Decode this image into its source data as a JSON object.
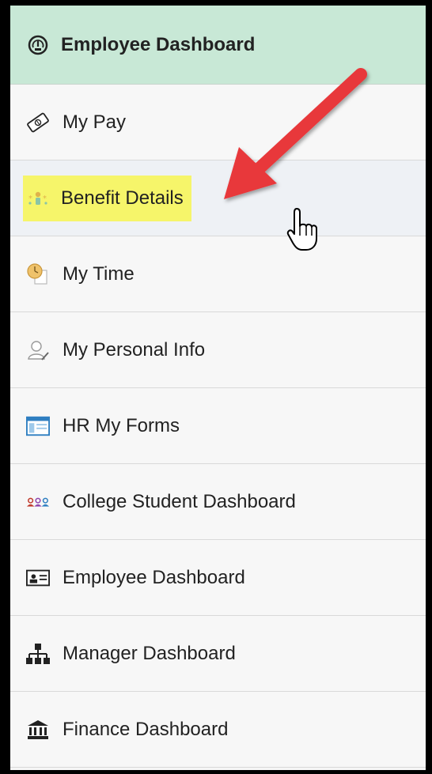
{
  "header": {
    "label": "Employee Dashboard",
    "icon": "dashboard-gauge-icon"
  },
  "items": [
    {
      "label": "My Pay",
      "icon": "money-icon"
    },
    {
      "label": "Benefit Details",
      "icon": "benefits-icon",
      "highlighted": true,
      "hovered": true
    },
    {
      "label": "My Time",
      "icon": "clock-icon"
    },
    {
      "label": "My Personal Info",
      "icon": "person-edit-icon"
    },
    {
      "label": "HR My Forms",
      "icon": "form-window-icon"
    },
    {
      "label": "College Student Dashboard",
      "icon": "people-group-icon"
    },
    {
      "label": "Employee Dashboard",
      "icon": "id-card-icon"
    },
    {
      "label": "Manager Dashboard",
      "icon": "org-chart-icon"
    },
    {
      "label": "Finance Dashboard",
      "icon": "bank-icon"
    }
  ],
  "colors": {
    "header_bg": "#c8e8d6",
    "highlight": "#f6f56a",
    "arrow": "#e8383b"
  }
}
